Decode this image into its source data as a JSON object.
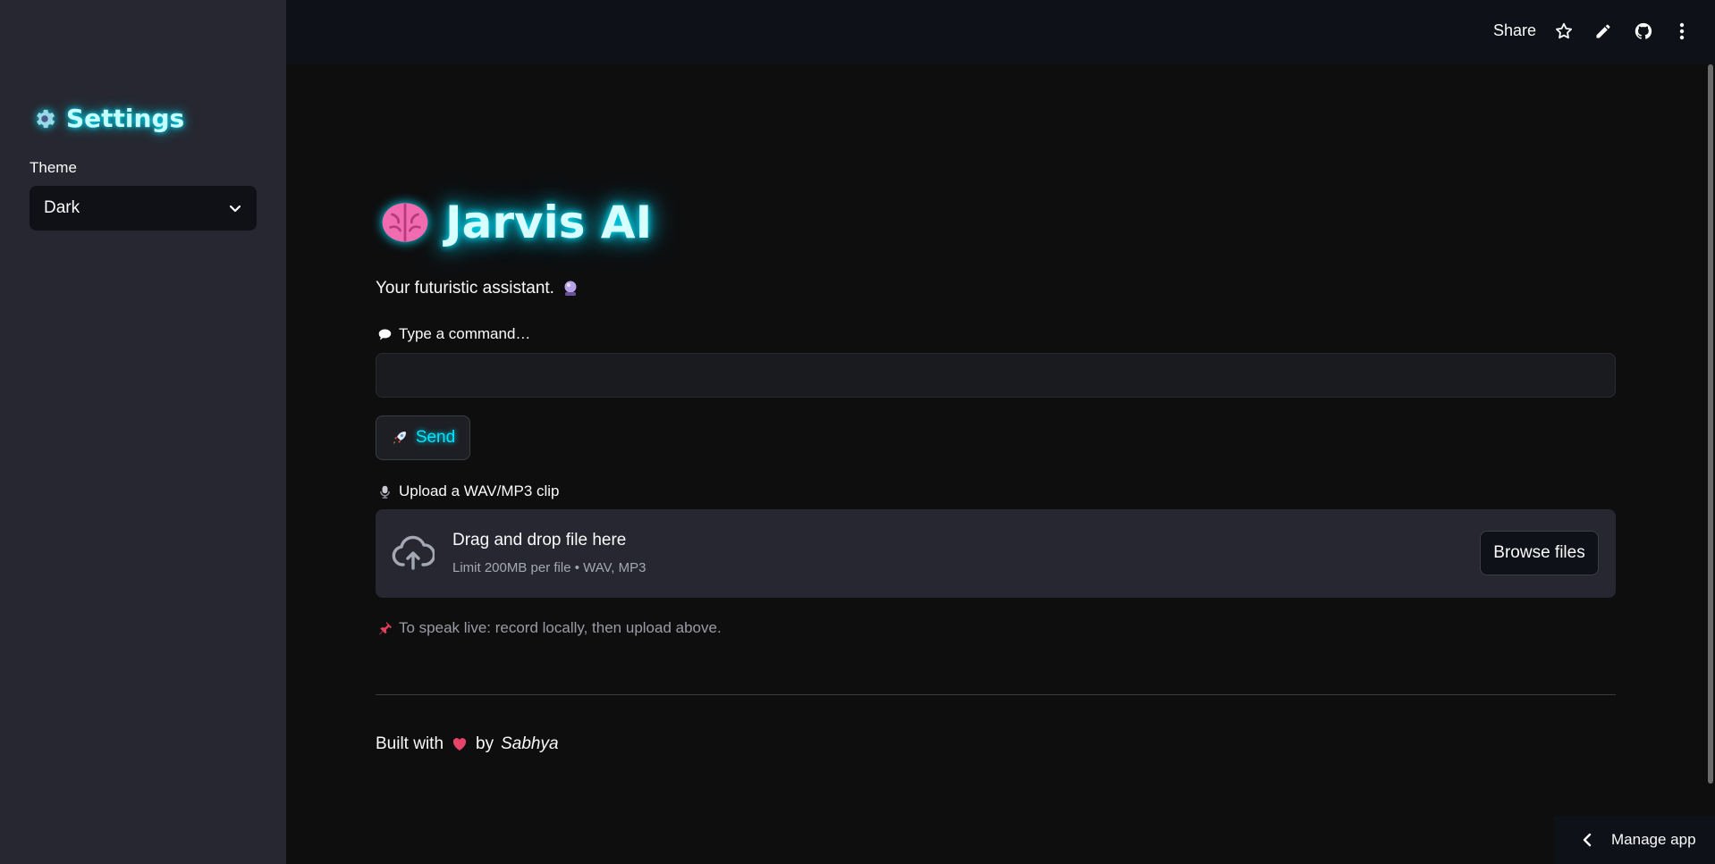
{
  "sidebar": {
    "title": "Settings",
    "theme_label": "Theme",
    "theme_value": "Dark"
  },
  "header": {
    "share_label": "Share",
    "icons": [
      "star-icon",
      "edit-icon",
      "github-icon",
      "more-vertical-icon"
    ]
  },
  "main": {
    "title": "Jarvis AI",
    "subtitle": "Your futuristic assistant.",
    "command_label": "Type a command…",
    "command_value": "",
    "send_label": "Send",
    "upload_label": "Upload a WAV/MP3 clip",
    "dropzone_title": "Drag and drop file here",
    "dropzone_limit": "Limit 200MB per file • WAV, MP3",
    "browse_label": "Browse files",
    "caption": "To speak live: record locally, then upload above.",
    "footer_prefix": "Built with",
    "footer_by": "by",
    "footer_author": "Sabhya"
  },
  "manage_app_label": "Manage app",
  "colors": {
    "accent_glow": "#00e5ff",
    "sidebar_bg": "#262730",
    "main_bg": "#0e0e0f",
    "heart": "#e8436a"
  }
}
